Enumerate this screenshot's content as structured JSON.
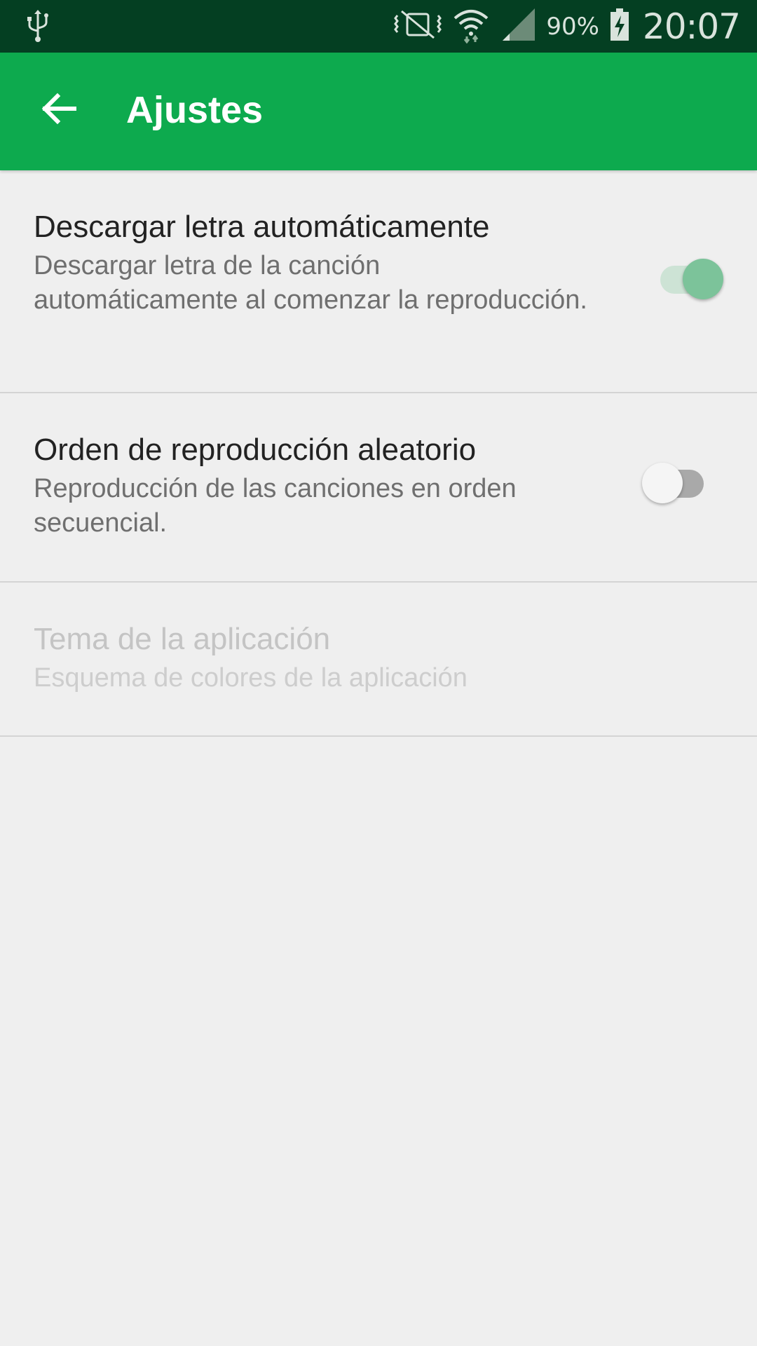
{
  "status_bar": {
    "battery_percent": "90%",
    "time": "20:07",
    "icons": [
      "usb-icon",
      "vibrate-icon",
      "wifi-icon",
      "cell-signal-icon",
      "battery-charging-icon"
    ]
  },
  "app_bar": {
    "title": "Ajustes",
    "back_icon": "arrow-back-icon",
    "color": "#0daa4e"
  },
  "settings": [
    {
      "title": "Descargar letra automáticamente",
      "summary": "Descargar letra de la canción automáticamente al comenzar la reproducción.",
      "toggle": "on",
      "enabled": true
    },
    {
      "title": "Orden de reproducción aleatorio",
      "summary": "Reproducción de las canciones en orden secuencial.",
      "toggle": "off",
      "enabled": true
    },
    {
      "title": "Tema de la aplicación",
      "summary": "Esquema de colores de la aplicación",
      "enabled": false
    }
  ]
}
